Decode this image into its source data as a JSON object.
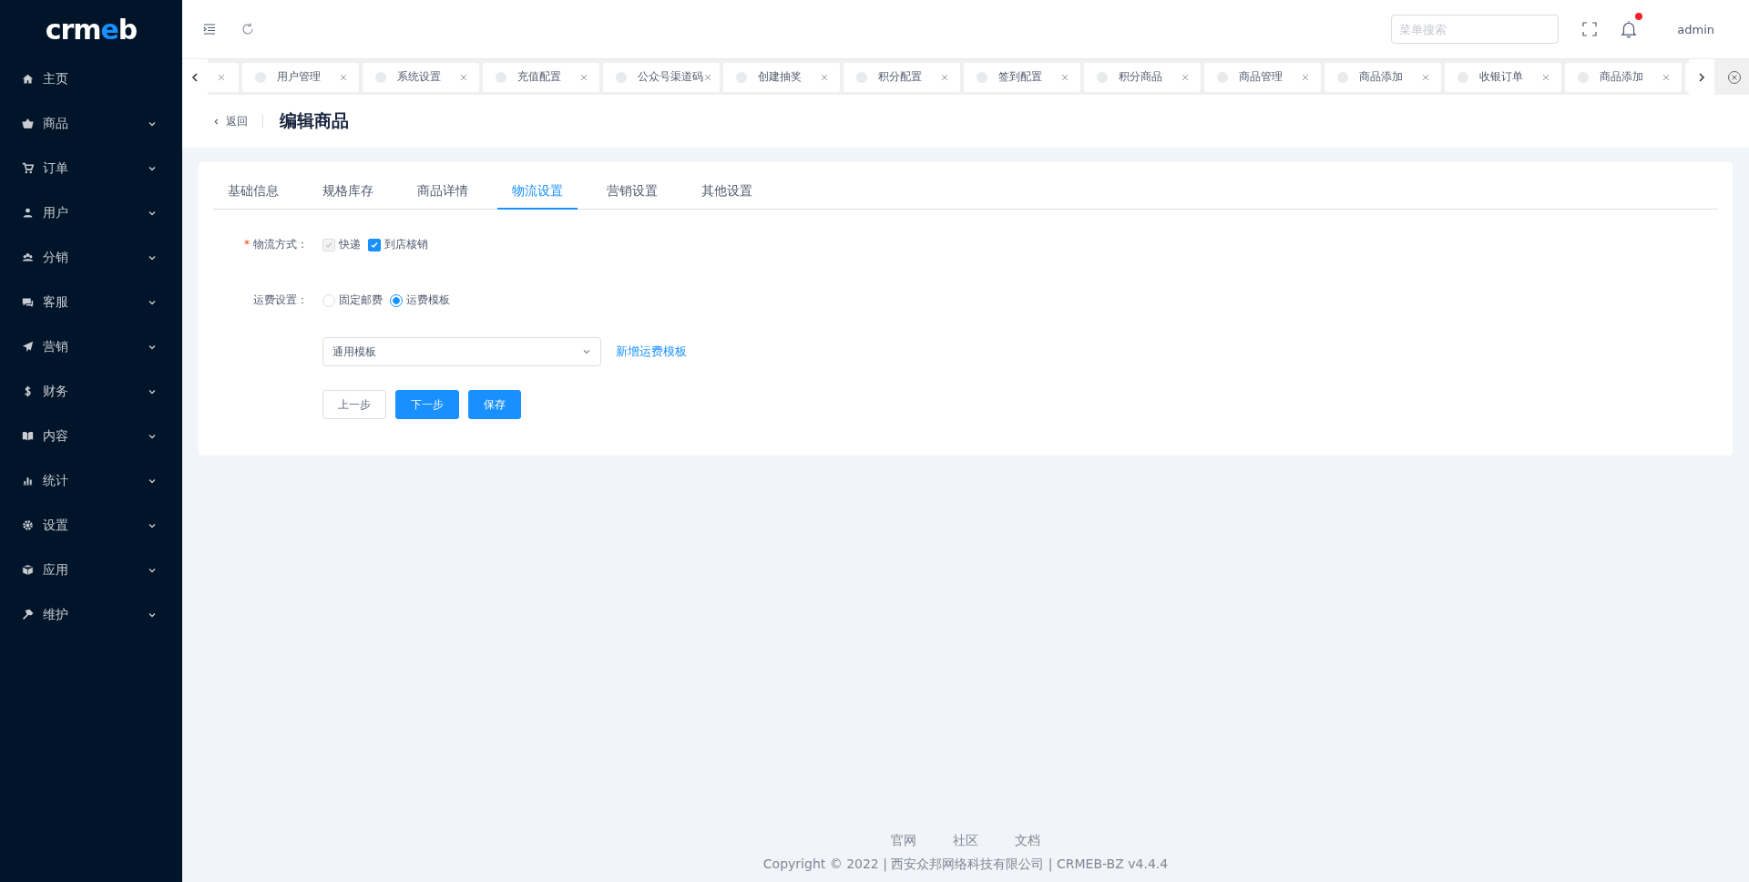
{
  "logo": {
    "parts": [
      {
        "text": "crm",
        "accent": false
      },
      {
        "text": "e",
        "accent": true
      },
      {
        "text": "b",
        "accent": false
      }
    ]
  },
  "sidebar": {
    "items": [
      {
        "label": "主页",
        "has_submenu": false
      },
      {
        "label": "商品",
        "has_submenu": true
      },
      {
        "label": "订单",
        "has_submenu": true
      },
      {
        "label": "用户",
        "has_submenu": true
      },
      {
        "label": "分销",
        "has_submenu": true
      },
      {
        "label": "客服",
        "has_submenu": true
      },
      {
        "label": "营销",
        "has_submenu": true
      },
      {
        "label": "财务",
        "has_submenu": true
      },
      {
        "label": "内容",
        "has_submenu": true
      },
      {
        "label": "统计",
        "has_submenu": true
      },
      {
        "label": "设置",
        "has_submenu": true
      },
      {
        "label": "应用",
        "has_submenu": true
      },
      {
        "label": "维护",
        "has_submenu": true
      }
    ]
  },
  "header": {
    "search": {
      "placeholder": "菜单搜索"
    },
    "has_notification": true,
    "user": "admin"
  },
  "open_tabs": [
    {
      "label": "用户管理",
      "selected": false
    },
    {
      "label": "系统设置",
      "selected": false
    },
    {
      "label": "充值配置",
      "selected": false
    },
    {
      "label": "公众号渠道码",
      "selected": false
    },
    {
      "label": "创建抽奖",
      "selected": false
    },
    {
      "label": "积分配置",
      "selected": false
    },
    {
      "label": "签到配置",
      "selected": false
    },
    {
      "label": "积分商品",
      "selected": false
    },
    {
      "label": "商品管理",
      "selected": false
    },
    {
      "label": "商品添加",
      "selected": false
    },
    {
      "label": "收银订单",
      "selected": false
    },
    {
      "label": "商品添加",
      "selected": false
    }
  ],
  "page_header": {
    "back": "返回",
    "title": "编辑商品"
  },
  "form_tabs": [
    {
      "label": "基础信息",
      "selected": false
    },
    {
      "label": "规格库存",
      "selected": false
    },
    {
      "label": "商品详情",
      "selected": false
    },
    {
      "label": "物流设置",
      "selected": true
    },
    {
      "label": "营销设置",
      "selected": false
    },
    {
      "label": "其他设置",
      "selected": false
    }
  ],
  "delivery": {
    "label": "物流方式：",
    "required_mark": "*",
    "options": [
      {
        "label": "快递",
        "checked": true,
        "disabled": true
      },
      {
        "label": "到店核销",
        "checked": true,
        "disabled": false
      }
    ]
  },
  "freight": {
    "label": "运费设置：",
    "options": [
      {
        "label": "固定邮费",
        "selected": false
      },
      {
        "label": "运费模板",
        "selected": true
      }
    ]
  },
  "template": {
    "value": "通用模板",
    "link": "新增运费模板"
  },
  "buttons": [
    {
      "label": "上一步",
      "kind": "default"
    },
    {
      "label": "下一步",
      "kind": "primary"
    },
    {
      "label": "保存",
      "kind": "primary"
    }
  ],
  "footer": {
    "links": [
      "官网",
      "社区",
      "文档"
    ],
    "copyright": "Copyright © 2022 | 西安众邦网络科技有限公司 | CRMEB-BZ v4.4.4"
  }
}
